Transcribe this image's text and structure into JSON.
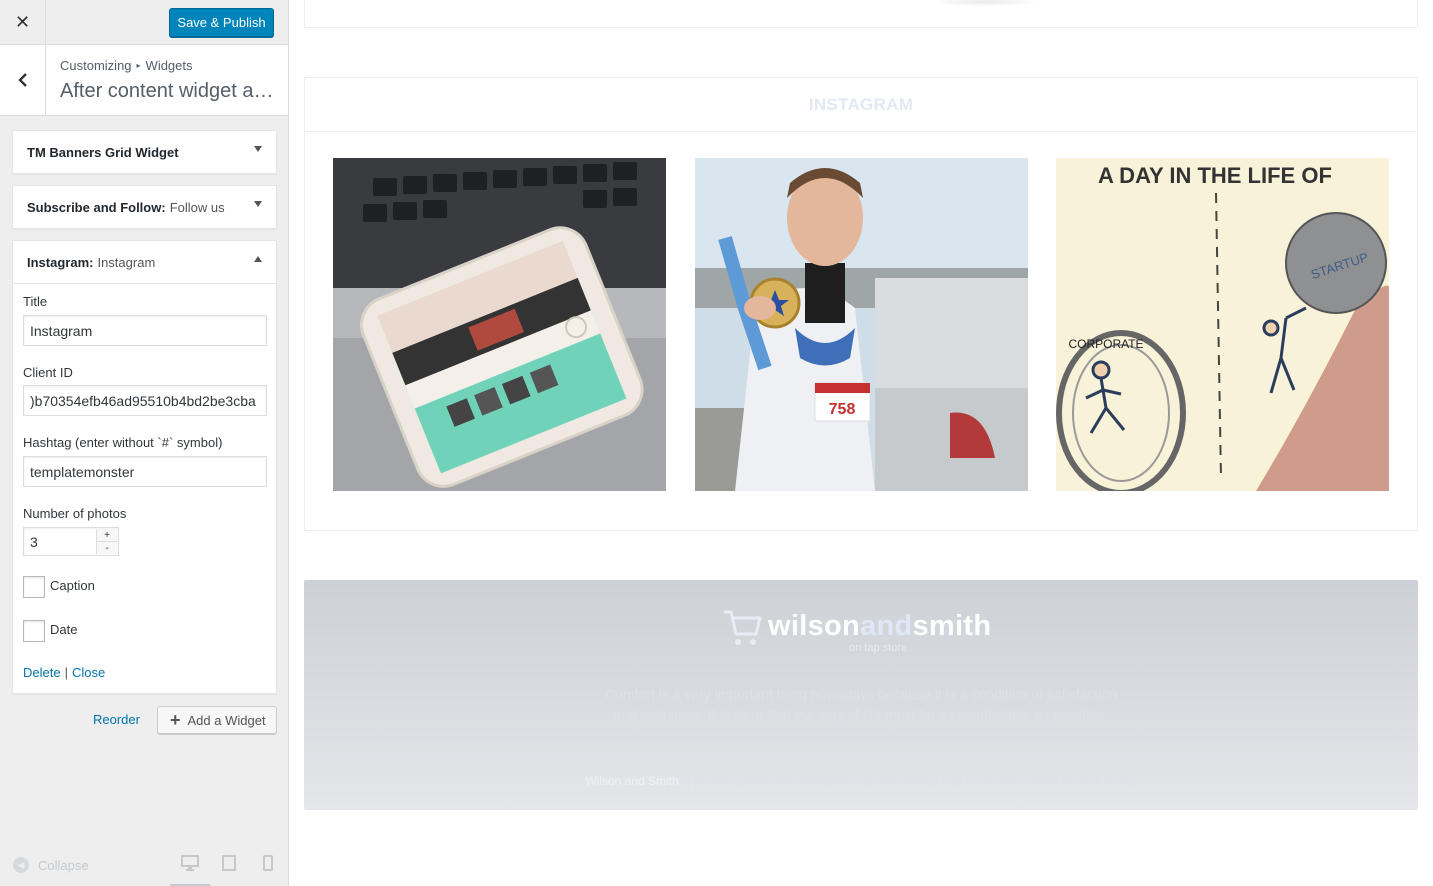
{
  "topbar": {
    "close_glyph": "✕",
    "publish_label": "Save & Publish"
  },
  "section": {
    "breadcrumb_root": "Customizing",
    "breadcrumb_arrow": "▸",
    "breadcrumb_current": "Widgets",
    "title": "After content widget area"
  },
  "widgets": [
    {
      "name": "TM Banners Grid Widget",
      "subtitle": ""
    },
    {
      "name": "Subscribe and Follow:",
      "subtitle": "Follow us"
    },
    {
      "name": "Instagram:",
      "subtitle": "Instagram"
    }
  ],
  "instagram_form": {
    "title_label": "Title",
    "title_value": "Instagram",
    "client_id_label": "Client ID",
    "client_id_value": ")b70354efb46ad95510b4bd2be3cba",
    "hashtag_label": "Hashtag (enter without `#` symbol)",
    "hashtag_value": "templatemonster",
    "photos_label": "Number of photos",
    "photos_value": "3",
    "stepper_up": "+",
    "stepper_down": "-",
    "caption_label": "Caption",
    "date_label": "Date",
    "delete_link": "Delete",
    "link_sep": "|",
    "close_link": "Close"
  },
  "actions": {
    "reorder_label": "Reorder",
    "add_widget_plus": "+",
    "add_widget_label": "Add a Widget"
  },
  "footer_bar": {
    "collapse_label": "Collapse",
    "devices": [
      "desktop-icon",
      "tablet-icon",
      "mobile-icon"
    ],
    "active_device": "desktop"
  },
  "preview": {
    "instagram_heading": "INSTAGRAM",
    "photo3_caption_top": "A DAY IN THE LIFE OF",
    "photo3_left_label": "CORPORATE",
    "photo3_right_label": "STARTUP",
    "photo2_bib": "758",
    "logo_part1": "wilson",
    "logo_part2": "and",
    "logo_part3": "smith",
    "logo_tagline": "on tap store",
    "footer_line1": "Comfort is a very important thing nowadays because it is a condition of satisfaction",
    "footer_line2": "and calmness. It is clear that our way of life must be as comfortable as possible.",
    "credit_brand": "Wilson and Smith",
    "credit_rest": " is proudly powered by WordPress Entries (RSS) and Comments (RSS) Privacy Policy"
  },
  "colors": {
    "accent": "#0085ba",
    "link": "#0073aa",
    "sidebar_bg": "#eeeeee",
    "footer_bg": "#cdd0d6"
  }
}
